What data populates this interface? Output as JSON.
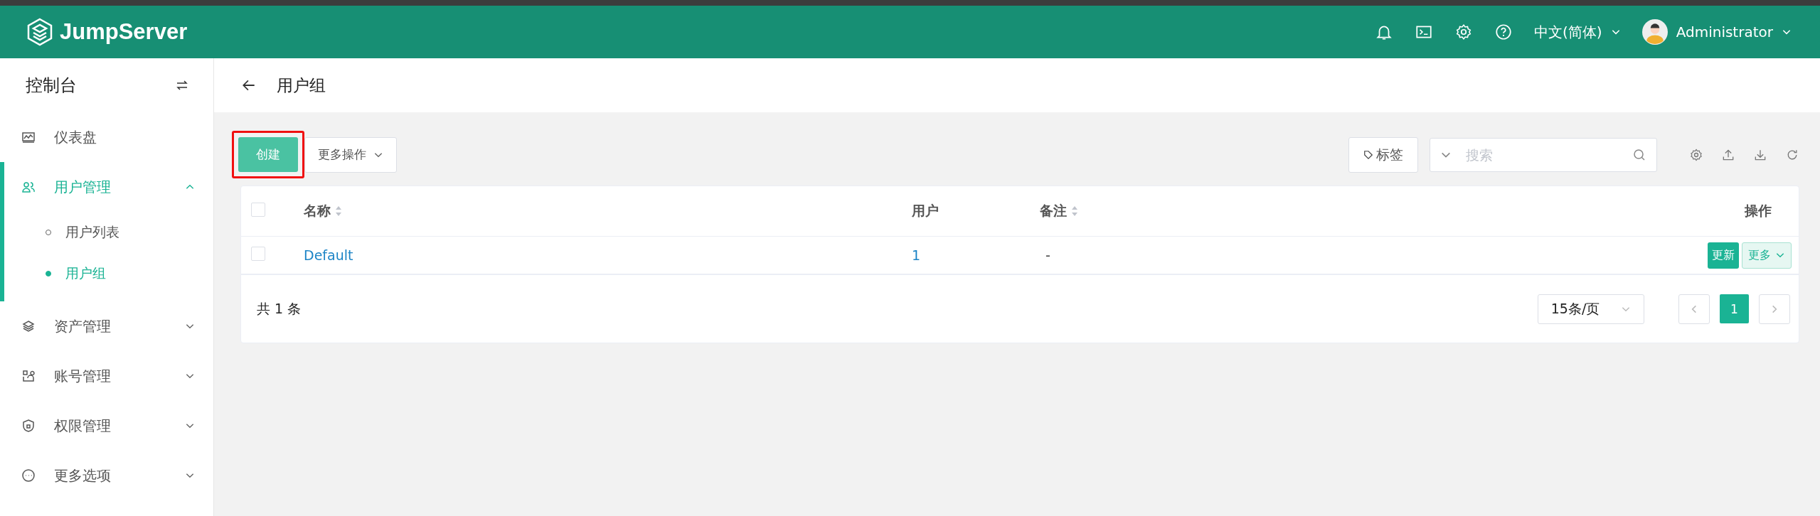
{
  "header": {
    "brand": "JumpServer",
    "language": "中文(简体)",
    "user": "Administrator"
  },
  "sidebar": {
    "title": "控制台",
    "items": [
      {
        "label": "仪表盘",
        "kind": "link",
        "selected": false
      },
      {
        "label": "用户管理",
        "kind": "group",
        "selected": true,
        "expanded": true,
        "children": [
          {
            "label": "用户列表",
            "selected": false
          },
          {
            "label": "用户组",
            "selected": true
          }
        ]
      },
      {
        "label": "资产管理",
        "kind": "group",
        "selected": false,
        "expanded": false
      },
      {
        "label": "账号管理",
        "kind": "group",
        "selected": false,
        "expanded": false
      },
      {
        "label": "权限管理",
        "kind": "group",
        "selected": false,
        "expanded": false
      },
      {
        "label": "更多选项",
        "kind": "group",
        "selected": false,
        "expanded": false
      }
    ]
  },
  "page": {
    "title": "用户组"
  },
  "toolbar": {
    "create": {
      "label": "创建",
      "highlighted": true
    },
    "more": "更多操作",
    "tag": "标签",
    "search": {
      "placeholder": "搜索"
    }
  },
  "table": {
    "select_all": false,
    "columns": [
      {
        "label": "名称",
        "sortable": true
      },
      {
        "label": "用户",
        "sortable": false
      },
      {
        "label": "备注",
        "sortable": true
      },
      {
        "label": "操作",
        "sortable": false
      }
    ],
    "rows": [
      {
        "checked": false,
        "name": "Default",
        "users": "1",
        "note": "-",
        "update": "更新",
        "more": "更多"
      }
    ],
    "total": "共 1 条",
    "page_size": "15条/页",
    "pages": [
      {
        "label": "1",
        "selected": true
      }
    ]
  }
}
